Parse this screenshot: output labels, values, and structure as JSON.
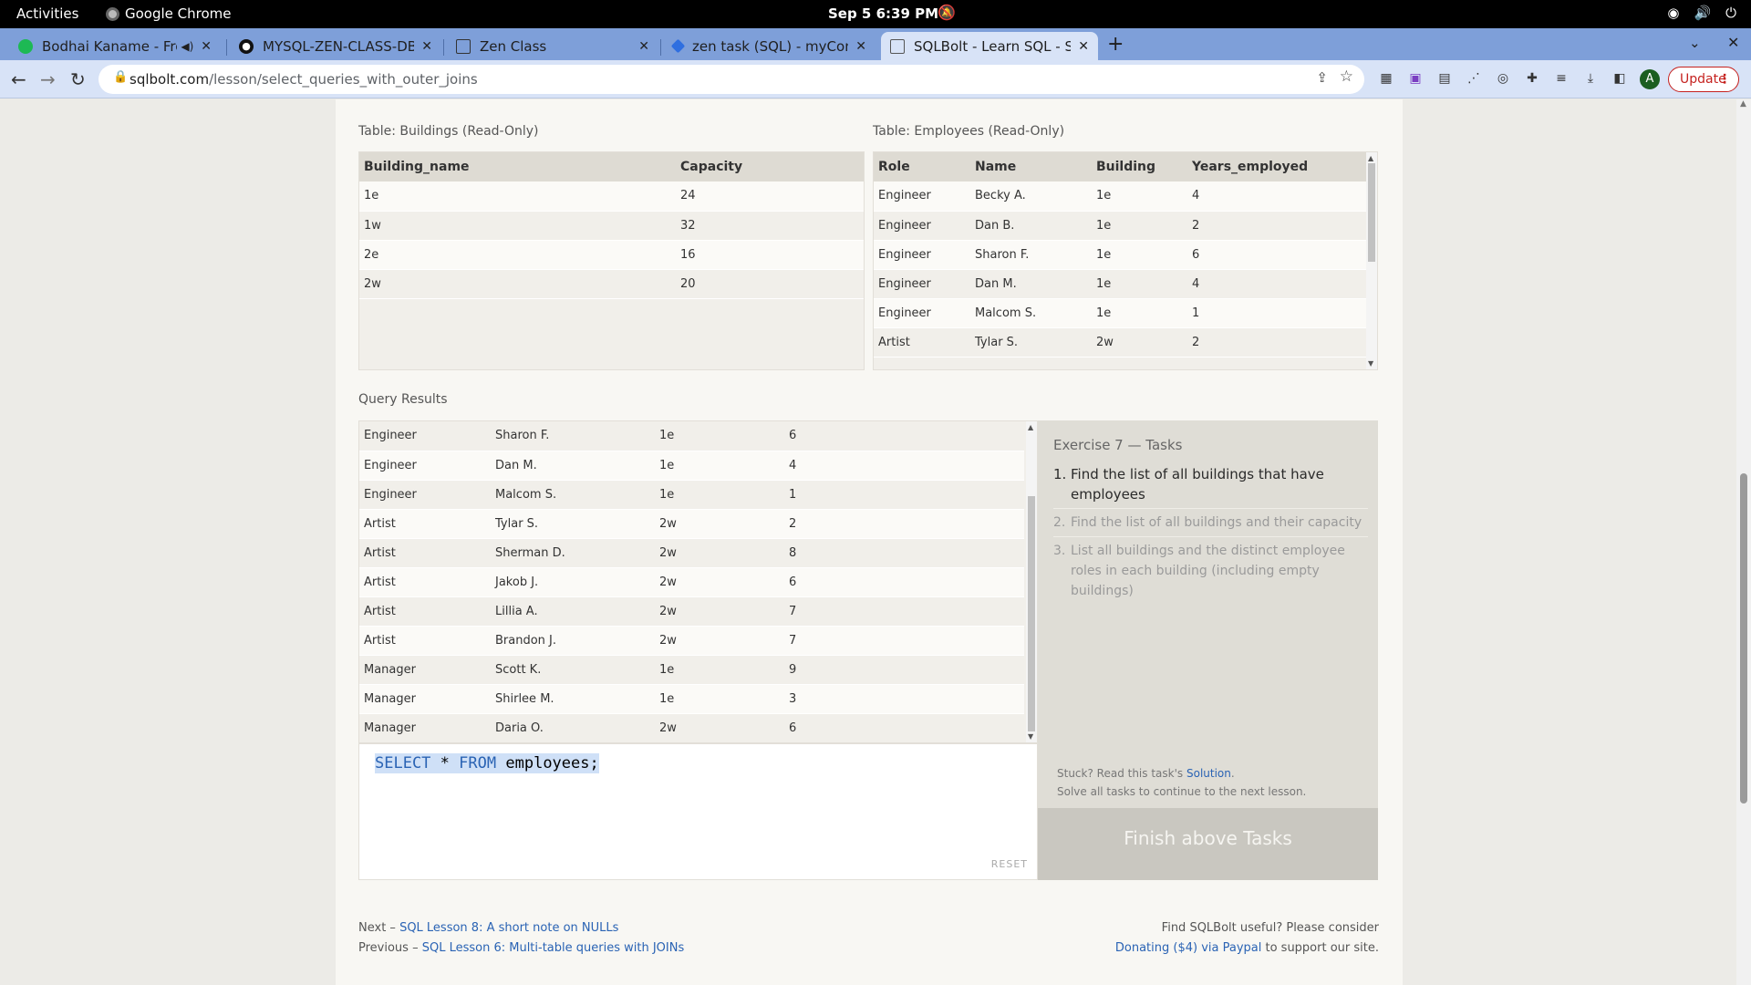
{
  "system_bar": {
    "activities": "Activities",
    "app_name": "Google Chrome",
    "clock": "Sep 5  6:39 PM"
  },
  "tabs": [
    {
      "label": "Bodhai Kaname - From",
      "active": false
    },
    {
      "label": "MYSQL-ZEN-CLASS-DB-M",
      "active": false
    },
    {
      "label": "Zen Class",
      "active": false
    },
    {
      "label": "zen task (SQL) - myCompil",
      "active": false
    },
    {
      "label": "SQLBolt - Learn SQL - SQL",
      "active": true
    }
  ],
  "toolbar": {
    "url_host": "sqlbolt.com",
    "url_path": "/lesson/select_queries_with_outer_joins",
    "avatar_letter": "A",
    "update_label": "Update"
  },
  "buildings": {
    "caption": "Table: Buildings (Read-Only)",
    "headers": [
      "Building_name",
      "Capacity"
    ],
    "rows": [
      [
        "1e",
        "24"
      ],
      [
        "1w",
        "32"
      ],
      [
        "2e",
        "16"
      ],
      [
        "2w",
        "20"
      ]
    ]
  },
  "employees": {
    "caption": "Table: Employees (Read-Only)",
    "headers": [
      "Role",
      "Name",
      "Building",
      "Years_employed"
    ],
    "rows": [
      [
        "Engineer",
        "Becky A.",
        "1e",
        "4"
      ],
      [
        "Engineer",
        "Dan B.",
        "1e",
        "2"
      ],
      [
        "Engineer",
        "Sharon F.",
        "1e",
        "6"
      ],
      [
        "Engineer",
        "Dan M.",
        "1e",
        "4"
      ],
      [
        "Engineer",
        "Malcom S.",
        "1e",
        "1"
      ],
      [
        "Artist",
        "Tylar S.",
        "2w",
        "2"
      ]
    ]
  },
  "results": {
    "caption": "Query Results",
    "rows": [
      [
        "Engineer",
        "Sharon F.",
        "1e",
        "6"
      ],
      [
        "Engineer",
        "Dan M.",
        "1e",
        "4"
      ],
      [
        "Engineer",
        "Malcom S.",
        "1e",
        "1"
      ],
      [
        "Artist",
        "Tylar S.",
        "2w",
        "2"
      ],
      [
        "Artist",
        "Sherman D.",
        "2w",
        "8"
      ],
      [
        "Artist",
        "Jakob J.",
        "2w",
        "6"
      ],
      [
        "Artist",
        "Lillia A.",
        "2w",
        "7"
      ],
      [
        "Artist",
        "Brandon J.",
        "2w",
        "7"
      ],
      [
        "Manager",
        "Scott K.",
        "1e",
        "9"
      ],
      [
        "Manager",
        "Shirlee M.",
        "1e",
        "3"
      ],
      [
        "Manager",
        "Daria O.",
        "2w",
        "6"
      ]
    ]
  },
  "editor": {
    "kw_select": "SELECT",
    "star": "*",
    "kw_from": "FROM",
    "rest": "employees;",
    "reset_label": "RESET"
  },
  "tasks": {
    "header": "Exercise 7 — Tasks",
    "items": [
      "Find the list of all buildings that have employees",
      "Find the list of all buildings and their capacity",
      "List all buildings and the distinct employee roles in each building (including empty buildings)"
    ],
    "stuck_prefix": "Stuck? Read this task's",
    "solution_link": "Solution",
    "stuck_suffix": ".",
    "continue_text": "Solve all tasks to continue to the next lesson.",
    "finish_label": "Finish above Tasks"
  },
  "footer": {
    "next_prefix": "Next –",
    "next_link": "SQL Lesson 8: A short note on NULLs",
    "prev_prefix": "Previous –",
    "prev_link": "SQL Lesson 6: Multi-table queries with JOINs",
    "support_line1": "Find SQLBolt useful? Please consider",
    "donate_link": "Donating ($4) via Paypal",
    "support_suffix": "to support our site."
  }
}
